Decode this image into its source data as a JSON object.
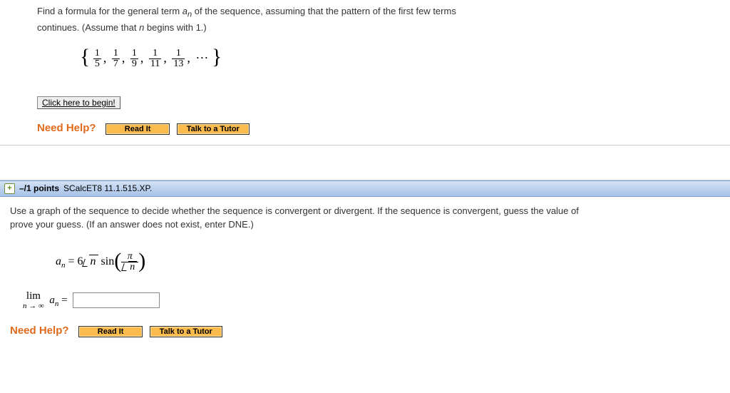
{
  "q1": {
    "prompt_line1_a": "Find a formula for the general term ",
    "prompt_line1_b": " of the sequence, assuming that the pattern of the first few terms",
    "prompt_line2_a": "continues. (Assume that ",
    "prompt_line2_b": " begins with 1.)",
    "a_label": "a",
    "n_label": "n",
    "seq_nums": [
      "1",
      "1",
      "1",
      "1",
      "1"
    ],
    "seq_dens": [
      "5",
      "7",
      "9",
      "11",
      "13"
    ],
    "ellipsis": "···",
    "begin_btn": "Click here to begin!",
    "need_help": "Need Help?",
    "read_it": "Read It",
    "tutor": "Talk to a Tutor"
  },
  "header": {
    "points": "–/1 points",
    "source": "SCalcET8 11.1.515.XP."
  },
  "q2": {
    "prompt_line1": "Use a graph of the sequence to decide whether the sequence is convergent or divergent. If the sequence is convergent, guess the value of",
    "prompt_line2": "prove your guess. (If an answer does not exist, enter DNE.)",
    "formula_lhs_a": "a",
    "formula_lhs_n": "n",
    "eq": " = ",
    "six": "6",
    "sqrt_n": "n",
    "sin": " sin",
    "pi": "π",
    "denom_n": "n",
    "lim_top": "lim",
    "lim_bot_a": "n",
    "lim_bot_b": " → ∞",
    "lim_rhs_a": "a",
    "lim_rhs_n": "n",
    "lim_eq": " = ",
    "need_help": "Need Help?",
    "read_it": "Read It",
    "tutor": "Talk to a Tutor"
  }
}
